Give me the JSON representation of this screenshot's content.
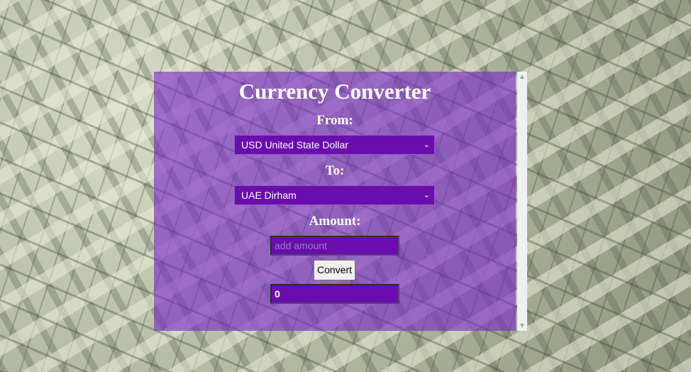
{
  "app": {
    "title": "Currency Converter"
  },
  "labels": {
    "from": "From:",
    "to": "To:",
    "amount": "Amount:"
  },
  "from_select": {
    "selected": "USD United State Dollar"
  },
  "to_select": {
    "selected": "UAE Dirham"
  },
  "amount_input": {
    "value": "",
    "placeholder": "add amount"
  },
  "convert_button": {
    "label": "Convert"
  },
  "result": {
    "value": "0"
  },
  "icons": {
    "dropdown": "chevron-down-icon",
    "scroll_up": "scroll-up-arrow-icon",
    "scroll_down": "scroll-down-arrow-icon"
  },
  "colors": {
    "panel": "#7828c8",
    "control_bg": "#6a0dad",
    "text": "#ffffff"
  }
}
